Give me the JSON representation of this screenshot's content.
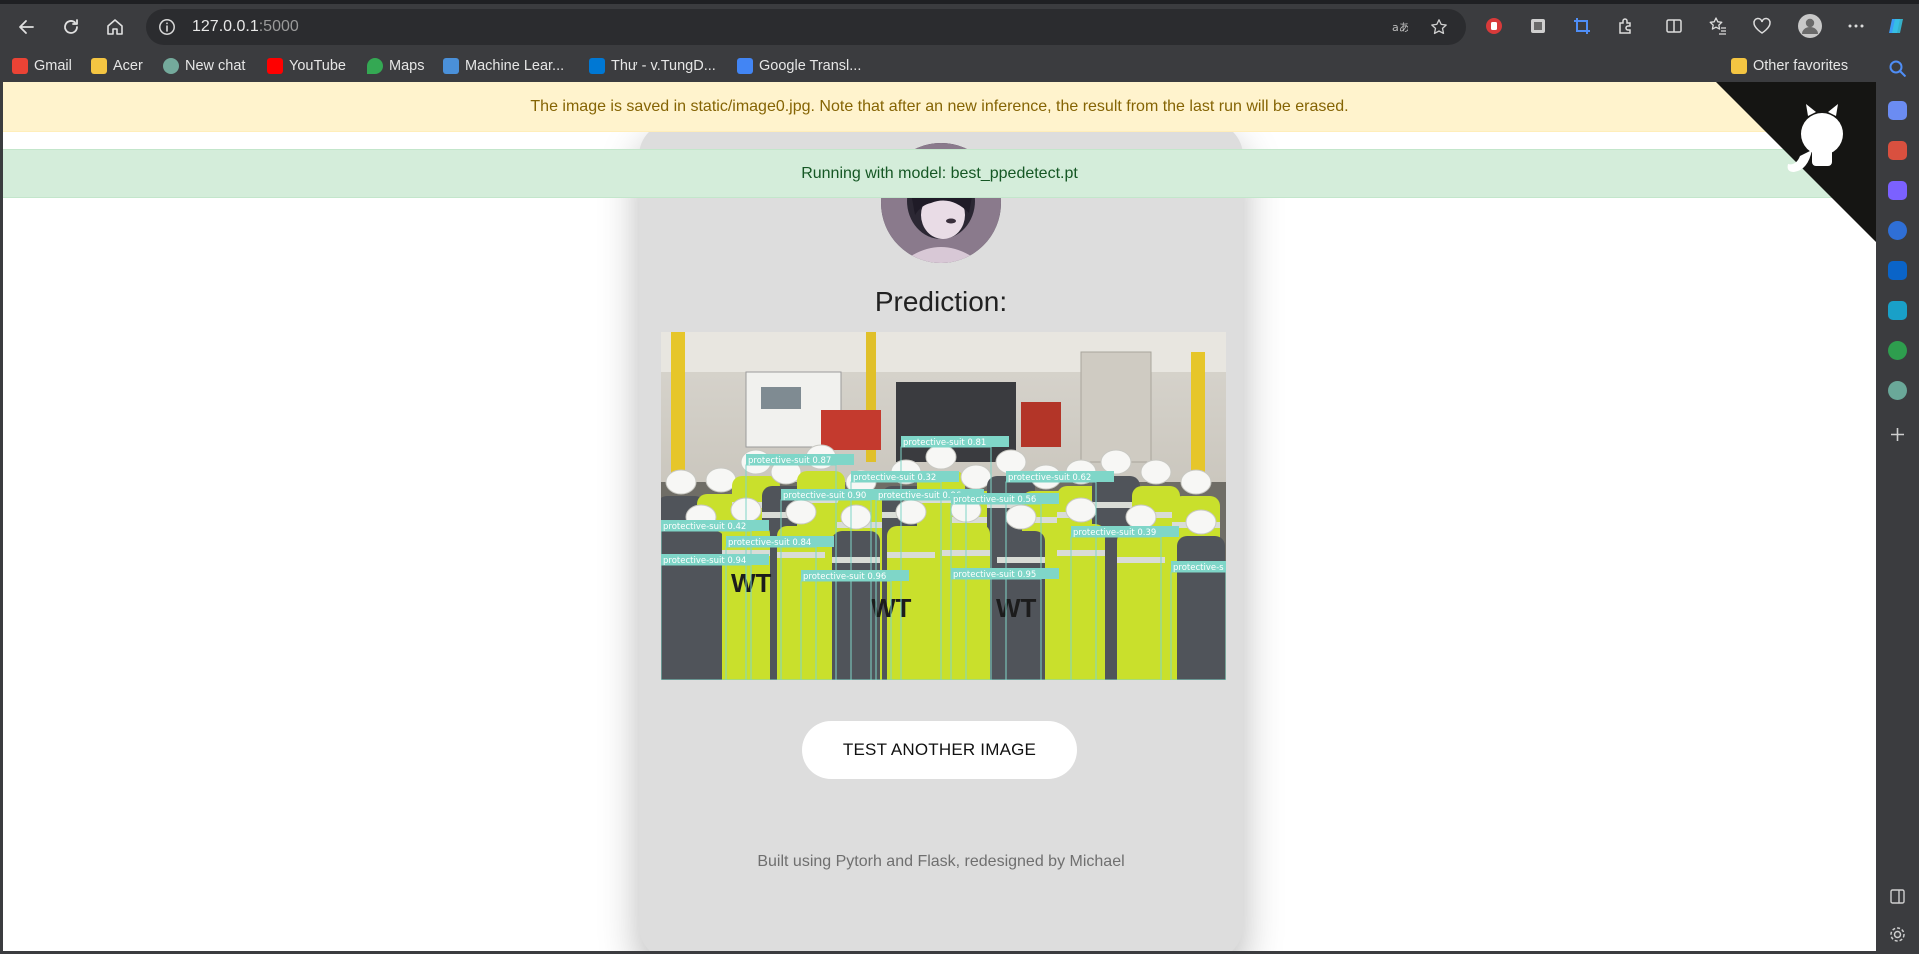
{
  "browser": {
    "url_host": "127.0.0.1",
    "url_port": ":5000",
    "bookmarks": [
      {
        "label": "Gmail",
        "color": "#ea4335"
      },
      {
        "label": "Acer",
        "color": "#f4c542"
      },
      {
        "label": "New chat",
        "color": "#74aa9c"
      },
      {
        "label": "YouTube",
        "color": "#ff0000"
      },
      {
        "label": "Maps",
        "color": "#34a853"
      },
      {
        "label": "Machine Lear...",
        "color": "#4a90d9"
      },
      {
        "label": "Thư - v.TungD...",
        "color": "#0078d4"
      },
      {
        "label": "Google Transl...",
        "color": "#4285f4"
      }
    ],
    "other_favorites": "Other favorites"
  },
  "alerts": {
    "warning": "The image is saved in static/image0.jpg. Note that after an new inference, the result from the last run will be erased.",
    "success": "Running with model: best_ppedetect.pt"
  },
  "main": {
    "title": "Prediction:",
    "button_label": "TEST ANOTHER IMAGE",
    "footer": "Built using Pytorh and Flask, redesigned by Michael"
  },
  "detections": [
    {
      "label": "protective-suit 0.81"
    },
    {
      "label": "protective-suit 0.87"
    },
    {
      "label": "protective-suit 0.32"
    },
    {
      "label": "protective-suit 0.62"
    },
    {
      "label": "protective-suit 0.90"
    },
    {
      "label": "protective-suit 0.96"
    },
    {
      "label": "protective-suit 0.56"
    },
    {
      "label": "protective-suit 0.42"
    },
    {
      "label": "protective-suit 0.84"
    },
    {
      "label": "protective-suit 0.39"
    },
    {
      "label": "protective-suit 0.94"
    },
    {
      "label": "protective-suit 0.96"
    },
    {
      "label": "protective-suit 0.95"
    },
    {
      "label": "protective-s"
    }
  ],
  "colors": {
    "box_color": "#7fd6c8",
    "vest_color": "#c9e02c",
    "warning_bg": "#fff3cd",
    "success_bg": "#d4edda",
    "corner_color": "#151513"
  }
}
